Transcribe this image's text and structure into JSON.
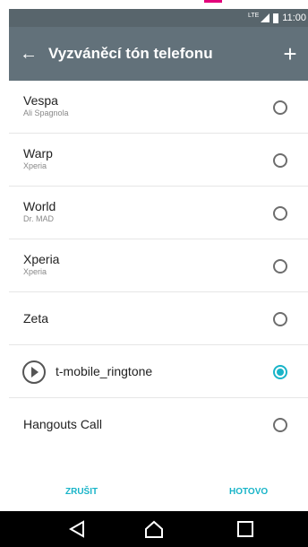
{
  "status": {
    "network": "LTE",
    "time": "11:00"
  },
  "app_bar": {
    "back_icon": "arrow-left-icon",
    "title": "Vyzváněcí tón telefonu",
    "add_icon": "plus-icon"
  },
  "ringtones": [
    {
      "title": "Vespa",
      "subtitle": "Ali Spagnola",
      "selected": false
    },
    {
      "title": "Warp",
      "subtitle": "Xperia",
      "selected": false
    },
    {
      "title": "World",
      "subtitle": "Dr. MAD",
      "selected": false
    },
    {
      "title": "Xperia",
      "subtitle": "Xperia",
      "selected": false
    },
    {
      "title": "Zeta",
      "subtitle": "",
      "selected": false
    },
    {
      "title": "t-mobile_ringtone",
      "subtitle": "",
      "selected": true,
      "has_play_button": true
    },
    {
      "title": "Hangouts Call",
      "subtitle": "",
      "selected": false
    }
  ],
  "actions": {
    "cancel": "ZRUŠIT",
    "done": "HOTOVO"
  },
  "colors": {
    "accent": "#18b4c8",
    "app_bar": "#62717a",
    "status_bar": "#58656c"
  }
}
